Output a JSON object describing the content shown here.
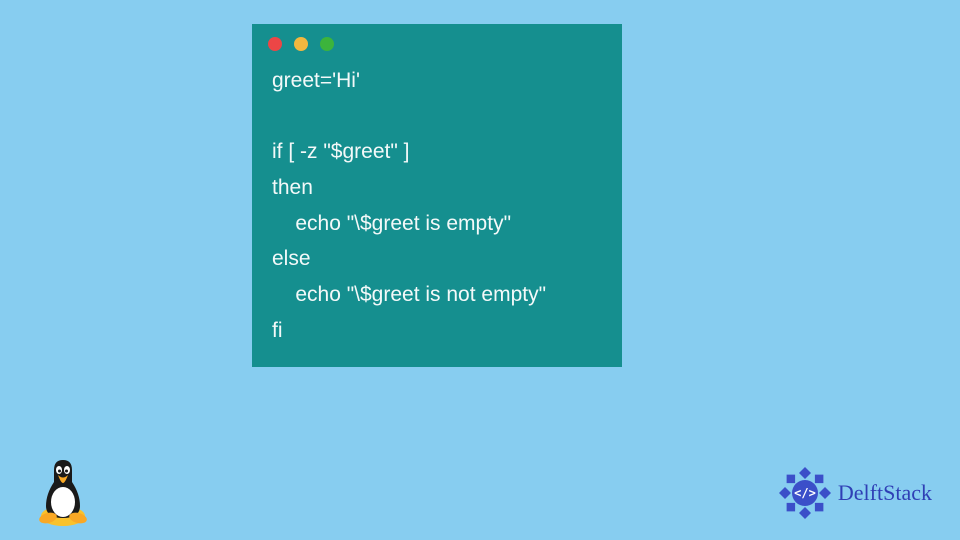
{
  "code": {
    "line1": "greet='Hi'",
    "line2": "",
    "line3": "if [ -z \"$greet\" ]",
    "line4": "then",
    "line5": "    echo \"\\$greet is empty\"",
    "line6": "else",
    "line7": "    echo \"\\$greet is not empty\"",
    "line8": "fi"
  },
  "traffic_lights": {
    "red": "#ec4646",
    "yellow": "#f3b73f",
    "green": "#3cb43c"
  },
  "branding": {
    "delftstack": "DelftStack",
    "tux_alt": "Linux Tux Penguin"
  },
  "colors": {
    "background": "#87cdf0",
    "window_bg": "#158f8f",
    "code_text": "#f3f9f9",
    "brand_color": "#2f3fb5"
  }
}
